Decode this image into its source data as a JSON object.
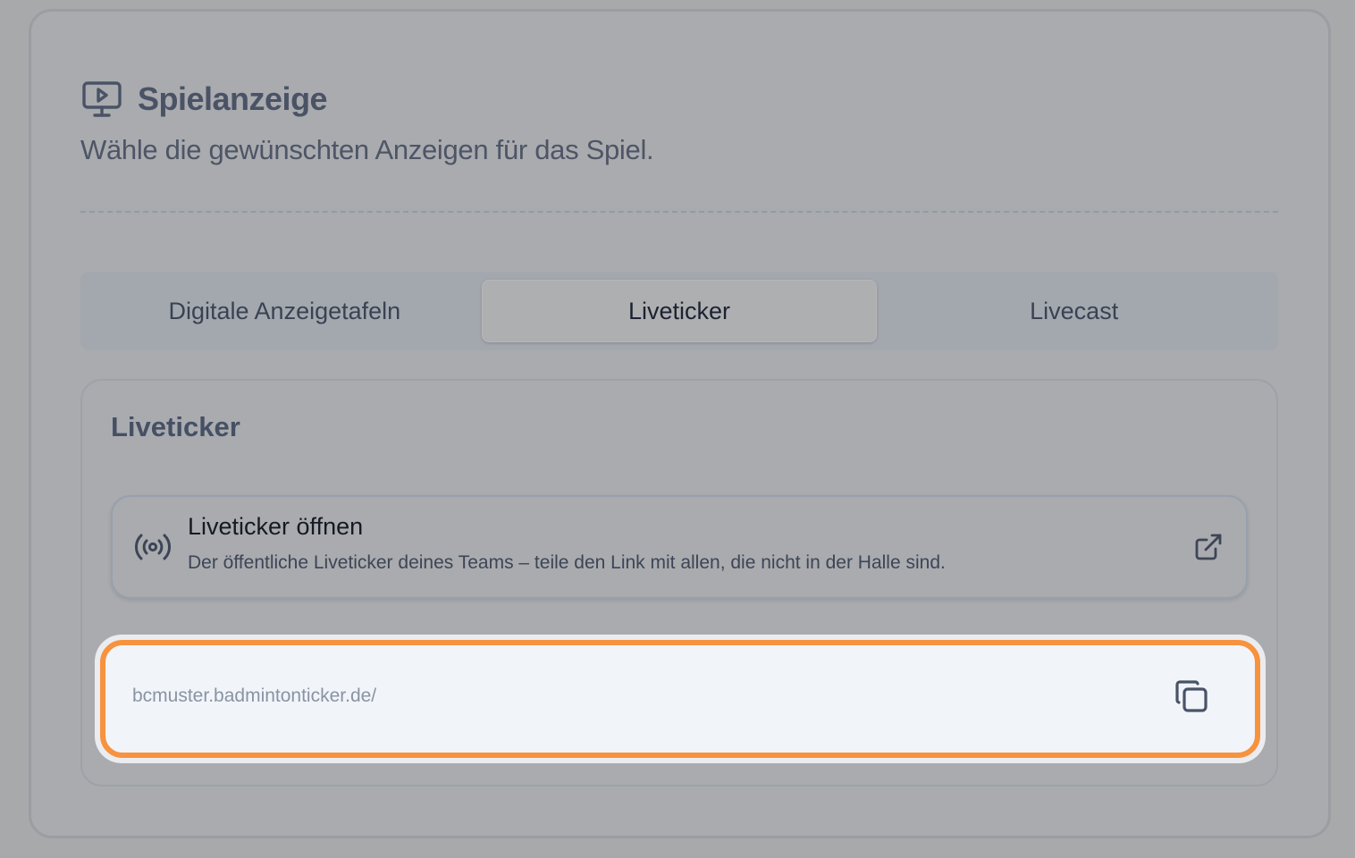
{
  "section": {
    "icon": "monitor-play-icon",
    "title": "Spielanzeige",
    "subtitle": "Wähle die gewünschten Anzeigen für das Spiel."
  },
  "tabs": [
    {
      "label": "Digitale Anzeigetafeln",
      "active": false
    },
    {
      "label": "Liveticker",
      "active": true
    },
    {
      "label": "Livecast",
      "active": false
    }
  ],
  "panel": {
    "title": "Liveticker",
    "open_card": {
      "icon": "broadcast-icon",
      "title": "Liveticker öffnen",
      "description": "Der öffentliche Liveticker deines Teams – teile den Link mit allen, die nicht in der Halle sind.",
      "action_icon": "external-link-icon"
    },
    "link_field": {
      "value": "bcmuster.badmintonticker.de/",
      "copy_icon": "copy-icon",
      "highlight_color": "#f7923e"
    }
  }
}
